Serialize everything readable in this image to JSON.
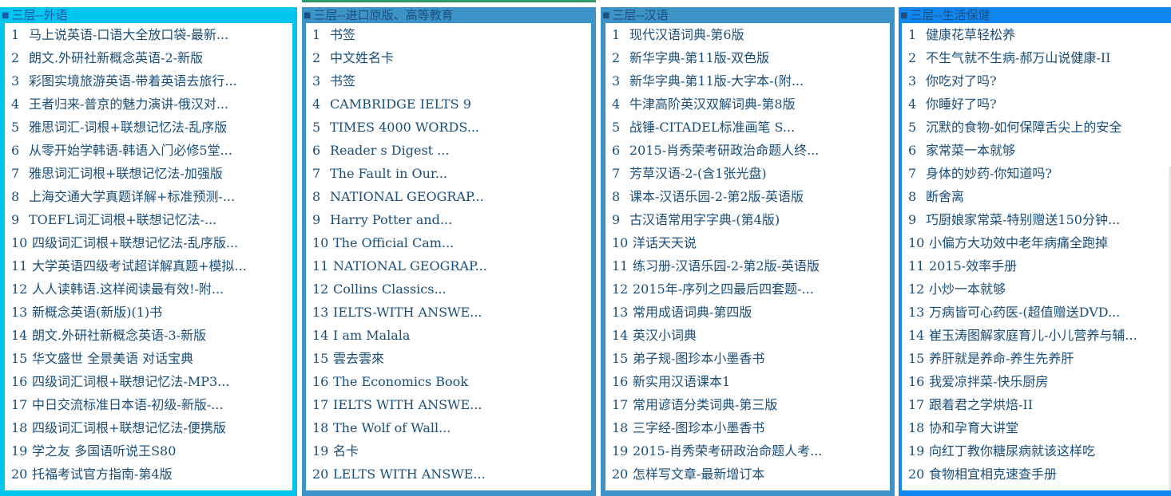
{
  "panels": [
    {
      "title": "三层--外语",
      "items": [
        "马上说英语-口语大全放口袋-最新...",
        "朗文.外研社新概念英语-2-新版",
        "彩图实境旅游英语-带着英语去旅行...",
        "王者归来-普京的魅力演讲-俄汉对...",
        "雅思词汇-词根+联想记忆法-乱序版",
        "从零开始学韩语-韩语入门必修5堂...",
        "雅思词汇词根+联想记忆法-加强版",
        "上海交通大学真题详解+标准预测-...",
        "TOEFL词汇词根+联想记忆法-...",
        "四级词汇词根+联想记忆法-乱序版...",
        "大学英语四级考试超详解真题+模拟...",
        "人人读韩语.这样阅读最有效!-附...",
        "新概念英语(新版)(1)书",
        "朗文.外研社新概念英语-3-新版",
        "华文盛世 全景美语 对话宝典",
        "四级词汇词根+联想记忆法-MP3...",
        "中日交流标准日本语-初级-新版-...",
        "四级词汇词根+联想记忆法-便携版",
        "学之友 多国语听说王S80",
        "托福考试官方指南-第4版"
      ]
    },
    {
      "title": "三层--进口原版、高等教育",
      "items": [
        "书签",
        "中文姓名卡",
        "书签",
        "CAMBRIDGE IELTS 9",
        "TIMES 4000 WORDS...",
        "Reader s Digest ...",
        "The Fault in Our...",
        "NATIONAL GEOGRAP...",
        "Harry Potter and...",
        "The Official Cam...",
        "NATIONAL GEOGRAP...",
        "Collins Classics...",
        "IELTS-WITH ANSWE...",
        "I am Malala",
        "雲去雲來",
        "The Economics Book",
        "IELTS WITH ANSWE...",
        "The Wolf of Wall...",
        "名卡",
        "LELTS WITH ANSWE..."
      ]
    },
    {
      "title": "三层--汉语",
      "items": [
        "现代汉语词典-第6版",
        "新华字典-第11版-双色版",
        "新华字典-第11版-大字本-(附...",
        "牛津高阶英汉双解词典-第8版",
        "战锤-CITADEL标准画笔 S...",
        "2015-肖秀荣考研政治命题人终...",
        "芳草汉语-2-(含1张光盘)",
        "课本-汉语乐园-2-第2版-英语版",
        "古汉语常用字字典-(第4版)",
        "洋话天天说",
        "练习册-汉语乐园-2-第2版-英语版",
        "2015年-序列之四最后四套题-...",
        "常用成语词典-第四版",
        "英汉小词典",
        "弟子规-图珍本小墨香书",
        "新实用汉语课本1",
        "常用谚语分类词典-第三版",
        "三字经-图珍本小墨香书",
        "2015-肖秀荣考研政治命题人考...",
        "怎样写文章-最新增订本"
      ]
    },
    {
      "title": "三层--生活保健",
      "items": [
        "健康花草轻松养",
        "不生气就不生病-郝万山说健康-II",
        "你吃对了吗?",
        "你睡好了吗?",
        "沉默的食物-如何保障舌尖上的安全",
        "家常菜一本就够",
        "身体的妙药-你知道吗?",
        "断舍离",
        "巧厨娘家常菜-特别赠送150分钟...",
        "小偏方大功效中老年病痛全跑掉",
        "2015-效率手册",
        "小炒一本就够",
        "万病皆可心药医-(超值赠送DVD...",
        "崔玉涛图解家庭育儿-小儿营养与辅...",
        "养肝就是养命-养生先养肝",
        "我爱凉拌菜-快乐厨房",
        "跟着君之学烘焙-II",
        "协和孕育大讲堂",
        "向红丁教你糖尿病就该这样吃",
        "食物相宜相克速查手册"
      ]
    }
  ]
}
